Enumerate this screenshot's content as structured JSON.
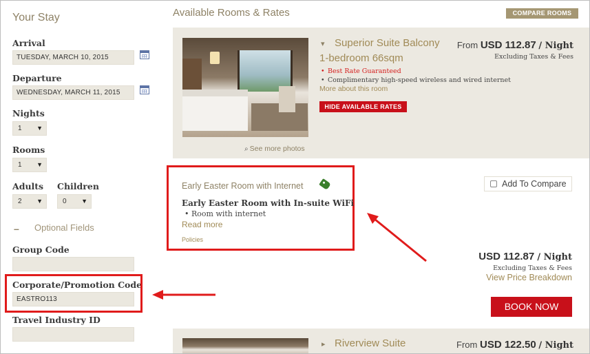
{
  "sidebar": {
    "title": "Your Stay",
    "arrival": {
      "label": "Arrival",
      "value": "TUESDAY, MARCH 10, 2015"
    },
    "departure": {
      "label": "Departure",
      "value": "WEDNESDAY, MARCH 11, 2015"
    },
    "nights": {
      "label": "Nights",
      "value": "1"
    },
    "rooms": {
      "label": "Rooms",
      "value": "1"
    },
    "adults": {
      "label": "Adults",
      "value": "2"
    },
    "children": {
      "label": "Children",
      "value": "0"
    },
    "optional_toggle": "–",
    "optional_label": "Optional Fields",
    "group_code": {
      "label": "Group Code",
      "value": ""
    },
    "corporate_code": {
      "label": "Corporate/Promotion Code",
      "value": "EASTRO113"
    },
    "travel_id": {
      "label": "Travel Industry ID",
      "value": ""
    }
  },
  "main": {
    "title": "Available Rooms & Rates",
    "compare_button": "COMPARE ROOMS",
    "room1": {
      "chevron": "▾",
      "name": "Superior Suite Balcony",
      "subtitle": "1-bedroom 66sqm",
      "badge": "Best Rate Guaranteed",
      "feature": "Complimentary high-speed wireless and wired internet",
      "more_link": "More about this room",
      "hide_button": "HIDE AVAILABLE RATES",
      "see_photos": "See more photos",
      "from": "From",
      "price": "USD 112.87",
      "per_night": "/ Night",
      "excl": "Excluding Taxes & Fees"
    },
    "rate": {
      "title": "Early Easter Room with Internet",
      "name": "Early Easter Room with In-suite WiFi",
      "bullet": "Room with internet",
      "read_more": "Read more",
      "policies": "Policies",
      "add_compare": "Add To Compare",
      "price": "USD 112.87",
      "per_night": "/ Night",
      "excl": "Excluding Taxes & Fees",
      "breakdown": "View Price Breakdown",
      "book": "BOOK NOW"
    },
    "room2": {
      "chevron": "▸",
      "name": "Riverview Suite",
      "from": "From",
      "price": "USD 122.50",
      "per_night": "/ Night"
    }
  },
  "colors": {
    "accent": "#a08a56",
    "brand_red": "#c8101a",
    "highlight": "#e01b1b",
    "panel": "#ece9e1"
  }
}
